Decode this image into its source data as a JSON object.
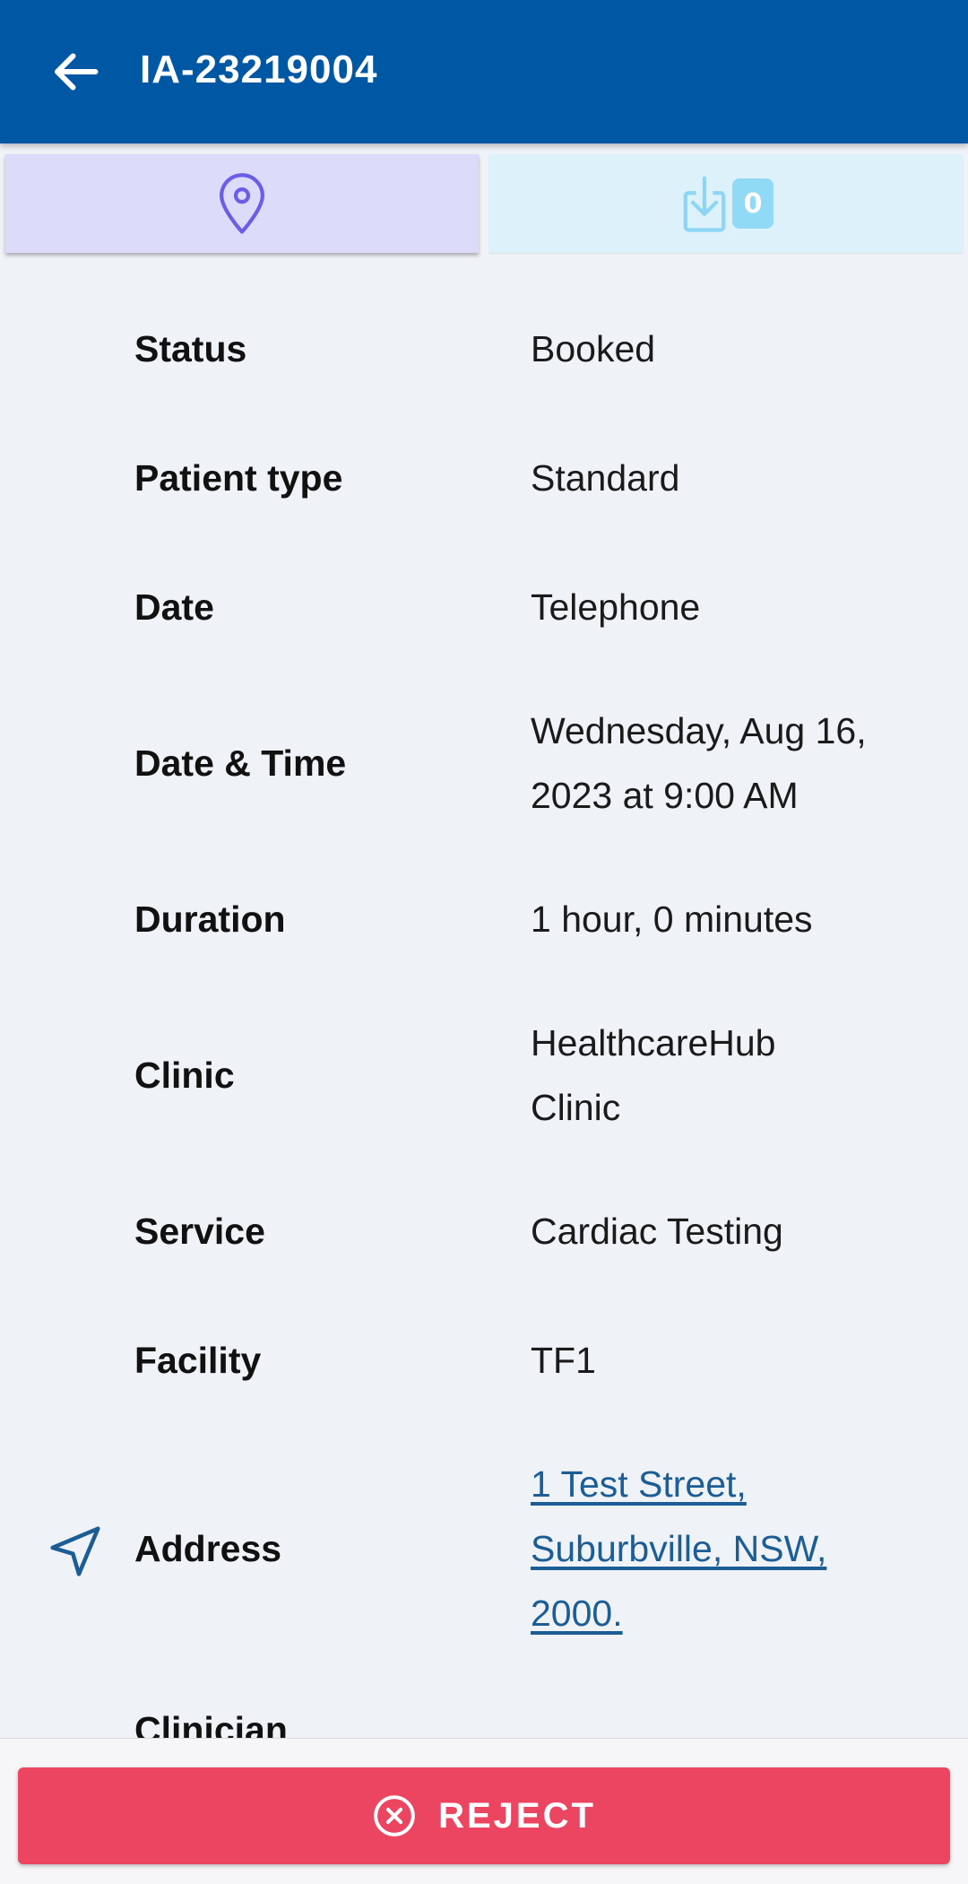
{
  "app_bar": {
    "title": "IA-23219004",
    "back_icon": "arrow-left-icon"
  },
  "tabs": [
    {
      "icon": "location-pin-icon",
      "active": true
    },
    {
      "icon": "download-icon",
      "badge": "0",
      "active": false
    }
  ],
  "details": [
    {
      "label": "Status",
      "value": "Booked"
    },
    {
      "label": "Patient type",
      "value": "Standard"
    },
    {
      "label": "Date",
      "value": "Telephone"
    },
    {
      "label": "Date & Time",
      "value": "Wednesday, Aug 16, 2023 at 9:00 AM"
    },
    {
      "label": "Duration",
      "value": "1 hour, 0 minutes"
    },
    {
      "label": "Clinic",
      "value": "HealthcareHub Clinic"
    },
    {
      "label": "Service",
      "value": "Cardiac Testing"
    },
    {
      "label": "Facility",
      "value": "TF1"
    },
    {
      "label": "Address",
      "value": "1 Test Street, Suburbville, NSW, 2000.",
      "icon": "navigation-arrow-icon"
    },
    {
      "label": "Clinician",
      "value": ""
    }
  ],
  "actions": {
    "reject_label": "REJECT",
    "reject_icon": "close-circle-icon"
  },
  "colors": {
    "app_bar": "#0057a3",
    "tab_active": "#dcdcfa",
    "tab_inactive": "#ddf1fb",
    "badge": "#90daf6",
    "link": "#1b5d94",
    "reject": "#eb4561",
    "background": "#eff2f7"
  }
}
